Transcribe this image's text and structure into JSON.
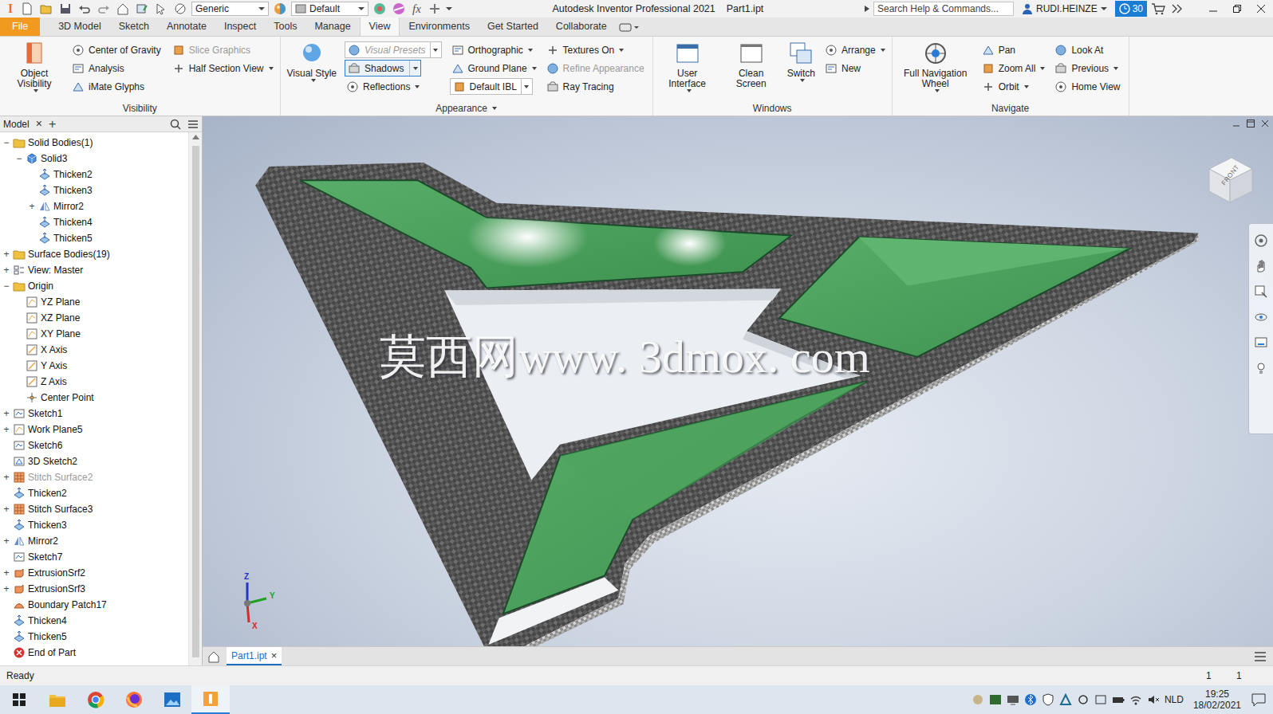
{
  "title_bar": {
    "logo": "I",
    "fx": "fx",
    "material": "Generic",
    "appearance": "Default",
    "app_title": "Autodesk Inventor Professional 2021",
    "file_name": "Part1.ipt",
    "search": {
      "placeholder": "Search Help & Commands..."
    },
    "user": "RUDI.HEINZE",
    "badge": "30"
  },
  "ribbon_tabs": [
    {
      "label": "File",
      "kind": "file",
      "selected": false
    },
    {
      "label": "3D Model",
      "kind": "tab",
      "selected": false
    },
    {
      "label": "Sketch",
      "kind": "tab",
      "selected": false
    },
    {
      "label": "Annotate",
      "kind": "tab",
      "selected": false
    },
    {
      "label": "Inspect",
      "kind": "tab",
      "selected": false
    },
    {
      "label": "Tools",
      "kind": "tab",
      "selected": false
    },
    {
      "label": "Manage",
      "kind": "tab",
      "selected": false
    },
    {
      "label": "View",
      "kind": "tab",
      "selected": true
    },
    {
      "label": "Environments",
      "kind": "tab",
      "selected": false
    },
    {
      "label": "Get Started",
      "kind": "tab",
      "selected": false
    },
    {
      "label": "Collaborate",
      "kind": "tab",
      "selected": false
    }
  ],
  "ribbon_groups": [
    {
      "title": "Visibility",
      "menu": false,
      "columns": [
        {
          "kind": "large",
          "items": [
            {
              "label": "Object Visibility",
              "kind": "button",
              "menu": true,
              "disabled": false,
              "on": false
            }
          ]
        },
        {
          "kind": "small",
          "items": [
            {
              "label": "Center of Gravity",
              "kind": "button",
              "menu": false,
              "disabled": false,
              "on": false
            },
            {
              "label": "Analysis",
              "kind": "button",
              "menu": false,
              "disabled": false,
              "on": false
            },
            {
              "label": "iMate Glyphs",
              "kind": "button",
              "menu": false,
              "disabled": false,
              "on": false
            }
          ]
        },
        {
          "kind": "small",
          "items": [
            {
              "label": "Slice Graphics",
              "kind": "button",
              "menu": false,
              "disabled": true,
              "on": false
            },
            {
              "label": "Half Section View",
              "kind": "button",
              "menu": true,
              "disabled": false,
              "on": false
            }
          ]
        }
      ]
    },
    {
      "title": "Appearance",
      "menu": true,
      "columns": [
        {
          "kind": "large",
          "items": [
            {
              "label": "Visual Style",
              "kind": "button",
              "menu": true,
              "disabled": false,
              "on": false
            }
          ]
        },
        {
          "kind": "small",
          "items": [
            {
              "label": "Visual Presets",
              "kind": "combo",
              "menu": true,
              "disabled": true,
              "on": false
            },
            {
              "label": "Shadows",
              "kind": "combo",
              "menu": true,
              "disabled": false,
              "on": true
            },
            {
              "label": "Reflections",
              "kind": "button",
              "menu": true,
              "disabled": false,
              "on": false
            }
          ]
        },
        {
          "kind": "small",
          "items": [
            {
              "label": "Orthographic",
              "kind": "button",
              "menu": true,
              "disabled": false,
              "on": false
            },
            {
              "label": "Ground Plane",
              "kind": "button",
              "menu": true,
              "disabled": false,
              "on": false
            },
            {
              "label": "Default IBL",
              "kind": "combo",
              "menu": true,
              "disabled": false,
              "on": false
            }
          ]
        },
        {
          "kind": "small",
          "items": [
            {
              "label": "Textures On",
              "kind": "button",
              "menu": true,
              "disabled": false,
              "on": false
            },
            {
              "label": "Refine Appearance",
              "kind": "button",
              "menu": false,
              "disabled": true,
              "on": false
            },
            {
              "label": "Ray Tracing",
              "kind": "button",
              "menu": false,
              "disabled": false,
              "on": false
            }
          ]
        }
      ]
    },
    {
      "title": "Windows",
      "menu": false,
      "columns": [
        {
          "kind": "large",
          "items": [
            {
              "label": "User Interface",
              "kind": "button",
              "menu": true,
              "disabled": false,
              "on": false
            }
          ]
        },
        {
          "kind": "large",
          "items": [
            {
              "label": "Clean Screen",
              "kind": "button",
              "menu": false,
              "disabled": false,
              "on": false
            }
          ]
        },
        {
          "kind": "large",
          "items": [
            {
              "label": "Switch",
              "kind": "button",
              "menu": true,
              "disabled": false,
              "on": false
            }
          ]
        },
        {
          "kind": "small",
          "items": [
            {
              "label": "Arrange",
              "kind": "button",
              "menu": true,
              "disabled": false,
              "on": false
            },
            {
              "label": "New",
              "kind": "button",
              "menu": false,
              "disabled": false,
              "on": false
            }
          ]
        }
      ]
    },
    {
      "title": "Navigate",
      "menu": false,
      "columns": [
        {
          "kind": "large",
          "items": [
            {
              "label": "Full Navigation Wheel",
              "kind": "button",
              "menu": true,
              "disabled": false,
              "on": false
            }
          ]
        },
        {
          "kind": "small",
          "items": [
            {
              "label": "Pan",
              "kind": "button",
              "menu": false,
              "disabled": false,
              "on": false
            },
            {
              "label": "Zoom All",
              "kind": "button",
              "menu": true,
              "disabled": false,
              "on": false
            },
            {
              "label": "Orbit",
              "kind": "button",
              "menu": true,
              "disabled": false,
              "on": false
            }
          ]
        },
        {
          "kind": "small",
          "items": [
            {
              "label": "Look At",
              "kind": "button",
              "menu": false,
              "disabled": false,
              "on": false
            },
            {
              "label": "Previous",
              "kind": "button",
              "menu": true,
              "disabled": false,
              "on": false
            },
            {
              "label": "Home View",
              "kind": "button",
              "menu": false,
              "disabled": false,
              "on": false
            }
          ]
        }
      ]
    }
  ],
  "browser": {
    "tabs": [
      {
        "label": "Model",
        "close": "×",
        "selected": true
      }
    ],
    "add": "+",
    "tree": [
      {
        "label": "Solid Bodies(1)",
        "kind": "folder",
        "toggle": "−",
        "dimmed": false,
        "children": [
          {
            "label": "Solid3",
            "kind": "solid",
            "toggle": "−",
            "dimmed": false,
            "children": [
              {
                "label": "Thicken2",
                "kind": "thicken",
                "dimmed": false
              },
              {
                "label": "Thicken3",
                "kind": "thicken",
                "dimmed": false
              },
              {
                "label": "Mirror2",
                "kind": "mirror",
                "toggle": "+",
                "dimmed": false
              },
              {
                "label": "Thicken4",
                "kind": "thicken",
                "dimmed": false
              },
              {
                "label": "Thicken5",
                "kind": "thicken",
                "dimmed": false
              }
            ]
          }
        ]
      },
      {
        "label": "Surface Bodies(19)",
        "kind": "folder",
        "toggle": "+",
        "dimmed": false
      },
      {
        "label": "View: Master",
        "kind": "view",
        "toggle": "+",
        "dimmed": false
      },
      {
        "label": "Origin",
        "kind": "folder",
        "toggle": "−",
        "dimmed": false,
        "children": [
          {
            "label": "YZ Plane",
            "kind": "plane",
            "dimmed": false
          },
          {
            "label": "XZ Plane",
            "kind": "plane",
            "dimmed": false
          },
          {
            "label": "XY Plane",
            "kind": "plane",
            "dimmed": false
          },
          {
            "label": "X Axis",
            "kind": "axis",
            "dimmed": false
          },
          {
            "label": "Y Axis",
            "kind": "axis",
            "dimmed": false
          },
          {
            "label": "Z Axis",
            "kind": "axis",
            "dimmed": false
          },
          {
            "label": "Center Point",
            "kind": "point",
            "dimmed": false
          }
        ]
      },
      {
        "label": "Sketch1",
        "kind": "sketch",
        "toggle": "+",
        "dimmed": false
      },
      {
        "label": "Work Plane5",
        "kind": "plane",
        "toggle": "+",
        "dimmed": false
      },
      {
        "label": "Sketch6",
        "kind": "sketch",
        "dimmed": false
      },
      {
        "label": "3D Sketch2",
        "kind": "sketch3d",
        "dimmed": false
      },
      {
        "label": "Stitch Surface2",
        "kind": "stitch",
        "toggle": "+",
        "dimmed": true
      },
      {
        "label": "Thicken2",
        "kind": "thicken",
        "dimmed": false
      },
      {
        "label": "Stitch Surface3",
        "kind": "stitch",
        "toggle": "+",
        "dimmed": false
      },
      {
        "label": "Thicken3",
        "kind": "thicken",
        "dimmed": false
      },
      {
        "label": "Mirror2",
        "kind": "mirror",
        "toggle": "+",
        "dimmed": false
      },
      {
        "label": "Sketch7",
        "kind": "sketch",
        "dimmed": false
      },
      {
        "label": "ExtrusionSrf2",
        "kind": "extrusion",
        "toggle": "+",
        "dimmed": false
      },
      {
        "label": "ExtrusionSrf3",
        "kind": "extrusion",
        "toggle": "+",
        "dimmed": false
      },
      {
        "label": "Boundary Patch17",
        "kind": "patch",
        "dimmed": false
      },
      {
        "label": "Thicken4",
        "kind": "thicken",
        "dimmed": false
      },
      {
        "label": "Thicken5",
        "kind": "thicken",
        "dimmed": false
      },
      {
        "label": "End of Part",
        "kind": "end",
        "dimmed": false
      }
    ]
  },
  "viewport": {
    "viewcube_label": "FRONT",
    "watermark": "莫西网www. 3dmox. com",
    "axes": [
      {
        "label": "Z",
        "color": "#2136c9"
      },
      {
        "label": "Y",
        "color": "#1fa11f"
      },
      {
        "label": "X",
        "color": "#d62b2b"
      }
    ]
  },
  "doc_tabs": [
    {
      "label": "Part1.ipt",
      "close": "×",
      "selected": true
    }
  ],
  "status_bar": {
    "text": "Ready",
    "counts": [
      "1",
      "1"
    ]
  },
  "taskbar": {
    "language": "NLD",
    "time": "19:25",
    "date": "18/02/2021"
  }
}
